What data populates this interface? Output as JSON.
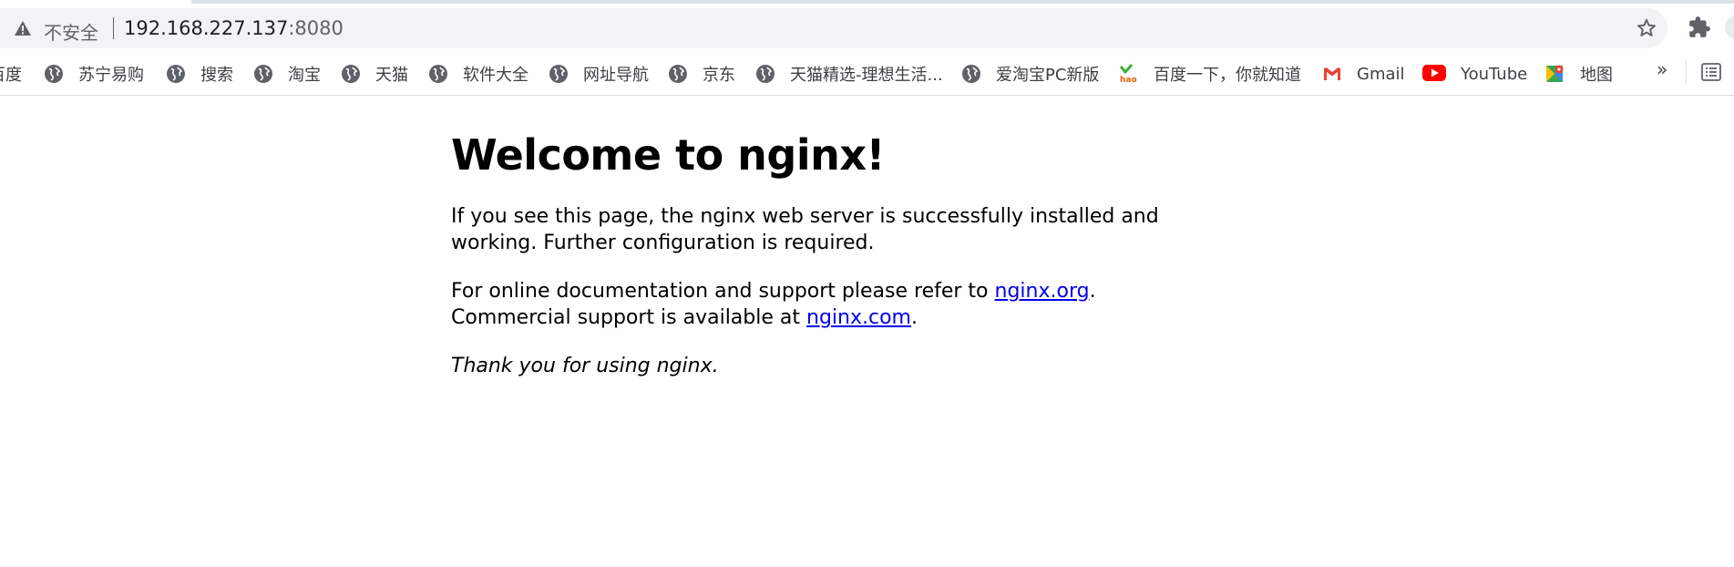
{
  "address_bar": {
    "security_label": "不安全",
    "url_host": "192.168.227.137",
    "url_port": ":8080"
  },
  "bookmarks": [
    {
      "label": "百度",
      "icon": "baidu-icon"
    },
    {
      "label": "苏宁易购",
      "icon": "globe-icon"
    },
    {
      "label": "搜索",
      "icon": "globe-icon"
    },
    {
      "label": "淘宝",
      "icon": "globe-icon"
    },
    {
      "label": "天猫",
      "icon": "globe-icon"
    },
    {
      "label": "软件大全",
      "icon": "globe-icon"
    },
    {
      "label": "网址导航",
      "icon": "globe-icon"
    },
    {
      "label": "京东",
      "icon": "globe-icon"
    },
    {
      "label": "天猫精选-理想生活...",
      "icon": "globe-icon"
    },
    {
      "label": "爱淘宝PC新版",
      "icon": "globe-icon"
    },
    {
      "label": "百度一下，你就知道",
      "icon": "hao123-icon"
    },
    {
      "label": "Gmail",
      "icon": "gmail-icon"
    },
    {
      "label": "YouTube",
      "icon": "youtube-icon"
    },
    {
      "label": "地图",
      "icon": "maps-icon"
    }
  ],
  "bookmarks_overflow": "»",
  "page": {
    "title": "Welcome to nginx!",
    "para1": "If you see this page, the nginx web server is successfully installed and working. Further configuration is required.",
    "para2_prefix": "For online documentation and support please refer to ",
    "link_org": "nginx.org",
    "para2_mid": ".",
    "para2_line2": "Commercial support is available at ",
    "link_com": "nginx.com",
    "para2_end": ".",
    "para3": "Thank you for using nginx."
  },
  "colors": {
    "link": "#0000ee",
    "youtube_red": "#ff0000",
    "gmail_red": "#ea4335",
    "omnibox_bg": "#f1f3f4"
  }
}
